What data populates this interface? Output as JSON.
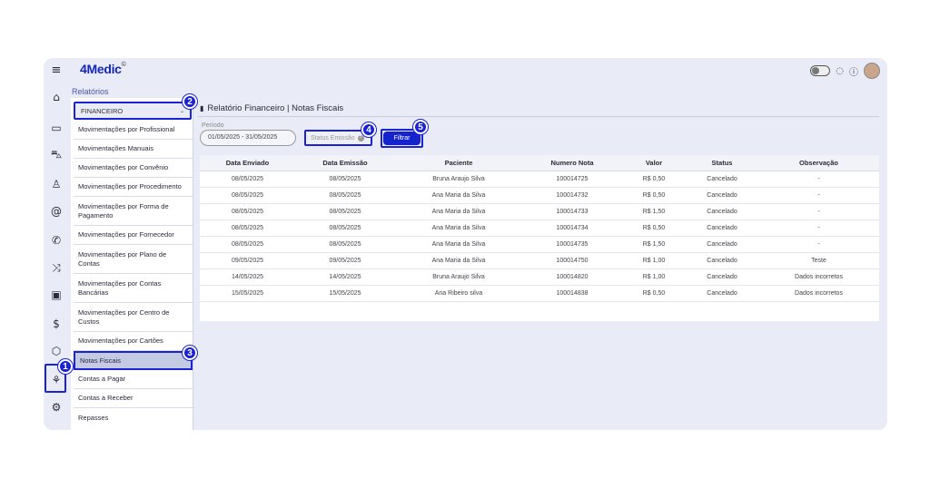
{
  "app": {
    "logo_main": "4Medic",
    "logo_reg": "©"
  },
  "rail": {
    "icons": [
      "menu-icon",
      "home-icon",
      "calendar-icon",
      "car-icon",
      "user-icon",
      "at-icon",
      "phone-icon",
      "shuffle-icon",
      "clipboard-icon",
      "dollar-icon",
      "box-icon",
      "reports-icon",
      "settings-icon"
    ]
  },
  "sidebar": {
    "section_label": "Relatórios",
    "dropdown_value": "FINANCEIRO",
    "items": [
      "Movimentações por Profissional",
      "Movimentações Manuais",
      "Movimentações por Convênio",
      "Movimentações por Procedimento",
      "Movimentações por Forma de Pagamento",
      "Movimentações por Fornecedor",
      "Movimentações por Plano de Contas",
      "Movimentações por Contas Bancárias",
      "Movimentações por Centro de Custos",
      "Movimentações por Cartões",
      "Notas Fiscais",
      "Contas a Pagar",
      "Contas a Receber",
      "Repasses"
    ],
    "active_item": "Notas Fiscais"
  },
  "main": {
    "title": "Relatório Financeiro | Notas Fiscais",
    "periodo_label": "Período",
    "periodo_value": "01/05/2025 - 31/05/2025",
    "status_placeholder": "Status Emissão",
    "filter_button": "Filtrar"
  },
  "table": {
    "columns": [
      "Data Enviado",
      "Data Emissão",
      "Paciente",
      "Numero Nota",
      "Valor",
      "Status",
      "Observação"
    ],
    "rows": [
      [
        "08/05/2025",
        "08/05/2025",
        "Bruna Araujo Silva",
        "100014725",
        "R$ 0,50",
        "Cancelado",
        "-"
      ],
      [
        "08/05/2025",
        "08/05/2025",
        "Ana Maria da Silva",
        "100014732",
        "R$ 0,50",
        "Cancelado",
        "-"
      ],
      [
        "08/05/2025",
        "08/05/2025",
        "Ana Maria da Silva",
        "100014733",
        "R$ 1,50",
        "Cancelado",
        "-"
      ],
      [
        "08/05/2025",
        "08/05/2025",
        "Ana Maria da Silva",
        "100014734",
        "R$ 0,50",
        "Cancelado",
        "-"
      ],
      [
        "08/05/2025",
        "08/05/2025",
        "Ana Maria da Silva",
        "100014735",
        "R$ 1,50",
        "Cancelado",
        "-"
      ],
      [
        "09/05/2025",
        "09/05/2025",
        "Ana Maria da Silva",
        "100014750",
        "R$ 1,00",
        "Cancelado",
        "Teste"
      ],
      [
        "14/05/2025",
        "14/05/2025",
        "Bruna Araujo Silva",
        "100014820",
        "R$ 1,00",
        "Cancelado",
        "Dados incorretos"
      ],
      [
        "15/05/2025",
        "15/05/2025",
        "Ana Ribeiro silva",
        "100014838",
        "R$ 0,50",
        "Cancelado",
        "Dados incorretos"
      ]
    ]
  },
  "callouts": [
    "1",
    "2",
    "3",
    "4",
    "5"
  ],
  "colors": {
    "accent": "#1a22d6",
    "panel": "#e9ecf7"
  }
}
